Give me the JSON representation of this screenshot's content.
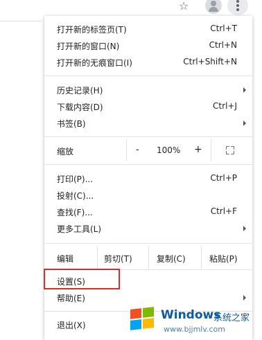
{
  "toolbar": {
    "star_icon": "☆",
    "avatar_icon": "account-avatar",
    "menu_icon": "more-vertical"
  },
  "menu": {
    "group1": [
      {
        "label": "打开新的标签页(T)",
        "shortcut": "Ctrl+T"
      },
      {
        "label": "打开新的窗口(N)",
        "shortcut": "Ctrl+N"
      },
      {
        "label": "打开新的无痕窗口(I)",
        "shortcut": "Ctrl+Shift+N"
      }
    ],
    "group2": [
      {
        "label": "历史记录(H)",
        "shortcut": ""
      },
      {
        "label": "下载内容(D)",
        "shortcut": "Ctrl+J"
      },
      {
        "label": "书签(B)",
        "shortcut": ""
      }
    ],
    "zoom": {
      "label": "缩放",
      "minus": "-",
      "value": "100%",
      "plus": "+"
    },
    "group3": [
      {
        "label": "打印(P)...",
        "shortcut": "Ctrl+P"
      },
      {
        "label": "投射(C)...",
        "shortcut": ""
      },
      {
        "label": "查找(F)...",
        "shortcut": "Ctrl+F"
      },
      {
        "label": "更多工具(L)",
        "shortcut": ""
      }
    ],
    "edit": {
      "label": "编辑",
      "cut": "剪切(T)",
      "copy": "复制(C)",
      "paste": "粘贴(P)"
    },
    "group4": [
      {
        "label": "设置(S)",
        "shortcut": ""
      },
      {
        "label": "帮助(E)",
        "shortcut": ""
      }
    ],
    "exit": {
      "label": "退出(X)"
    }
  },
  "watermark": {
    "brand": "Windows",
    "tagline": "系统之家",
    "url": "www.bjjmlv.com"
  },
  "colors": {
    "highlight": "#d32f2f",
    "watermark": "#0a5aa8"
  }
}
